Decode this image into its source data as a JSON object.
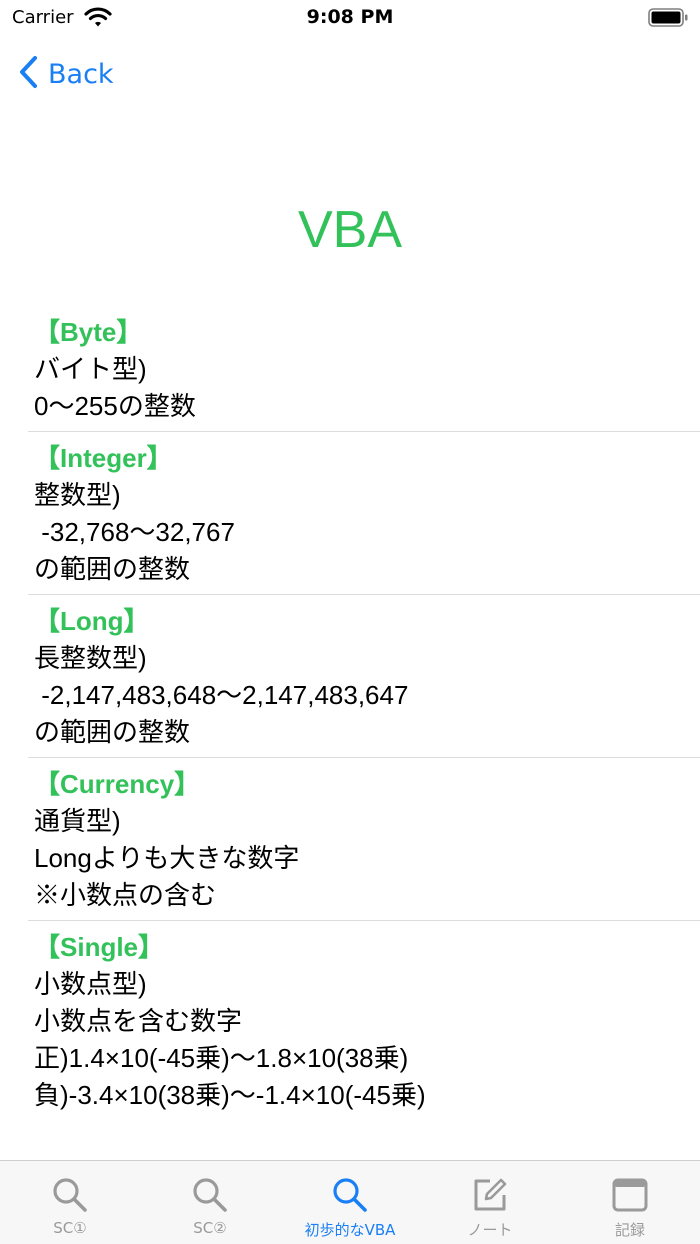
{
  "status": {
    "carrier": "Carrier",
    "time": "9:08 PM"
  },
  "nav": {
    "back_label": "Back"
  },
  "title": "VBA",
  "entries": [
    {
      "head": "【Byte】",
      "lines": [
        "バイト型)",
        "0～255の整数"
      ]
    },
    {
      "head": "【Integer】",
      "lines": [
        "整数型)",
        " -32,768～32,767",
        "の範囲の整数"
      ]
    },
    {
      "head": "【Long】",
      "lines": [
        "長整数型)",
        " -2,147,483,648～2,147,483,647",
        "の範囲の整数"
      ]
    },
    {
      "head": "【Currency】",
      "lines": [
        "通貨型)",
        "Longよりも大きな数字",
        "※小数点の含む"
      ]
    },
    {
      "head": "【Single】",
      "lines": [
        "小数点型)",
        "小数点を含む数字",
        "正)1.4×10(-45乗)～1.8×10(38乗)",
        "負)-3.4×10(38乗)～-1.4×10(-45乗)"
      ]
    }
  ],
  "tabs": [
    {
      "label": "SC①",
      "icon": "search-icon",
      "active": false
    },
    {
      "label": "SC②",
      "icon": "search-icon",
      "active": false
    },
    {
      "label": "初歩的なVBA",
      "icon": "search-icon",
      "active": true
    },
    {
      "label": "ノート",
      "icon": "compose-icon",
      "active": false
    },
    {
      "label": "記録",
      "icon": "window-icon",
      "active": false
    }
  ],
  "colors": {
    "accent": "#1a7ff5",
    "heading": "#33c15a",
    "inactive": "#9a9a9a"
  }
}
